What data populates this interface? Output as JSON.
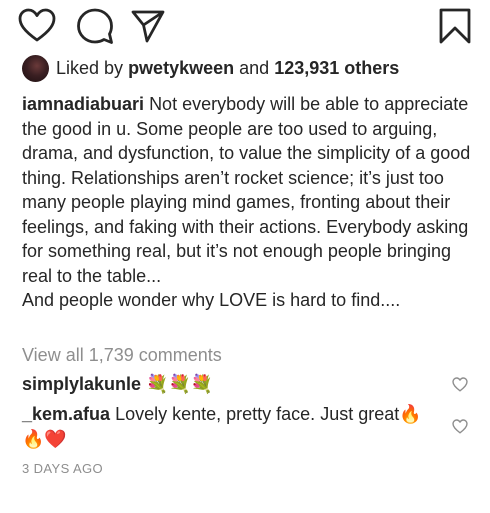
{
  "actions": {
    "like_icon": "heart-outline-icon",
    "comment_icon": "comment-bubble-icon",
    "share_icon": "paper-plane-icon",
    "save_icon": "bookmark-icon"
  },
  "likes": {
    "prefix": "Liked by",
    "user": "pwetykween",
    "connector": "and",
    "others": "123,931 others"
  },
  "caption": {
    "username": "iamnadiabuari",
    "text": "Not everybody will be able to appreciate the good in u. Some people are too used to arguing, drama, and dysfunction, to value the simplicity of a good thing. Relationships aren’t rocket science; it’s just too many people playing mind games, fronting about their feelings, and faking with their actions. Everybody asking for something real, but it’s not enough people bringing real to the table...",
    "second_line": "And people wonder why LOVE is hard to find...."
  },
  "view_all_comments": "View all 1,739 comments",
  "comments": [
    {
      "username": "simplylakunle",
      "text": "💐💐💐"
    },
    {
      "username": "_kem.afua",
      "text": "Lovely kente, pretty face. Just great🔥🔥❤️"
    }
  ],
  "timestamp": "3 DAYS AGO",
  "colors": {
    "text": "#262626",
    "muted": "#8e8e8e",
    "background": "#ffffff"
  }
}
